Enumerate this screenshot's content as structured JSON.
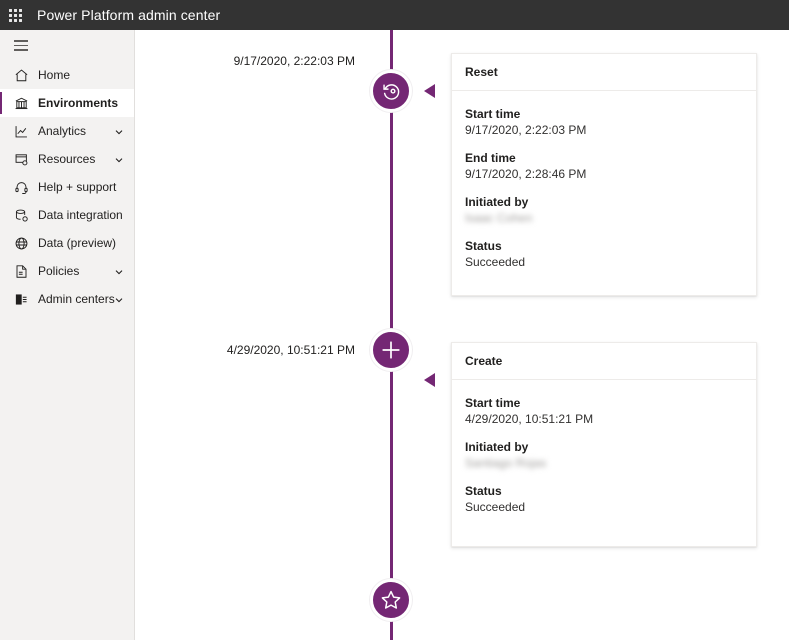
{
  "suite_bar": {
    "waffle_icon": "waffle-grid-icon",
    "title": "Power Platform admin center"
  },
  "sidebar": {
    "toggle_icon": "hamburger-menu-icon",
    "items": [
      {
        "label": "Home",
        "icon": "home-icon",
        "selected": false,
        "has_chevron": false
      },
      {
        "label": "Environments",
        "icon": "environments-icon",
        "selected": true,
        "has_chevron": false
      },
      {
        "label": "Analytics",
        "icon": "analytics-icon",
        "selected": false,
        "has_chevron": true
      },
      {
        "label": "Resources",
        "icon": "resources-icon",
        "selected": false,
        "has_chevron": true
      },
      {
        "label": "Help + support",
        "icon": "headset-icon",
        "selected": false,
        "has_chevron": false
      },
      {
        "label": "Data integration",
        "icon": "data-integration-icon",
        "selected": false,
        "has_chevron": false
      },
      {
        "label": "Data (preview)",
        "icon": "data-preview-icon",
        "selected": false,
        "has_chevron": false
      },
      {
        "label": "Policies",
        "icon": "policies-icon",
        "selected": false,
        "has_chevron": true
      },
      {
        "label": "Admin centers",
        "icon": "admin-centers-icon",
        "selected": false,
        "has_chevron": true
      }
    ]
  },
  "timeline": {
    "accent_color": "#742774",
    "events": [
      {
        "stamp": "9/17/2020, 2:22:03 PM",
        "node_icon": "reset-circular-arrow-icon",
        "card": {
          "title": "Reset",
          "fields": [
            {
              "label": "Start time",
              "value": "9/17/2020, 2:22:03 PM",
              "redacted": false
            },
            {
              "label": "End time",
              "value": "9/17/2020, 2:28:46 PM",
              "redacted": false
            },
            {
              "label": "Initiated by",
              "value": "Isaac Cohen",
              "redacted": true
            },
            {
              "label": "Status",
              "value": "Succeeded",
              "redacted": false
            }
          ]
        }
      },
      {
        "stamp": "4/29/2020, 10:51:21 PM",
        "node_icon": "plus-icon",
        "card": {
          "title": "Create",
          "fields": [
            {
              "label": "Start time",
              "value": "4/29/2020, 10:51:21 PM",
              "redacted": false
            },
            {
              "label": "Initiated by",
              "value": "Santiago Rojas",
              "redacted": true
            },
            {
              "label": "Status",
              "value": "Succeeded",
              "redacted": false
            }
          ]
        }
      }
    ],
    "terminal_node_icon": "star-icon"
  }
}
